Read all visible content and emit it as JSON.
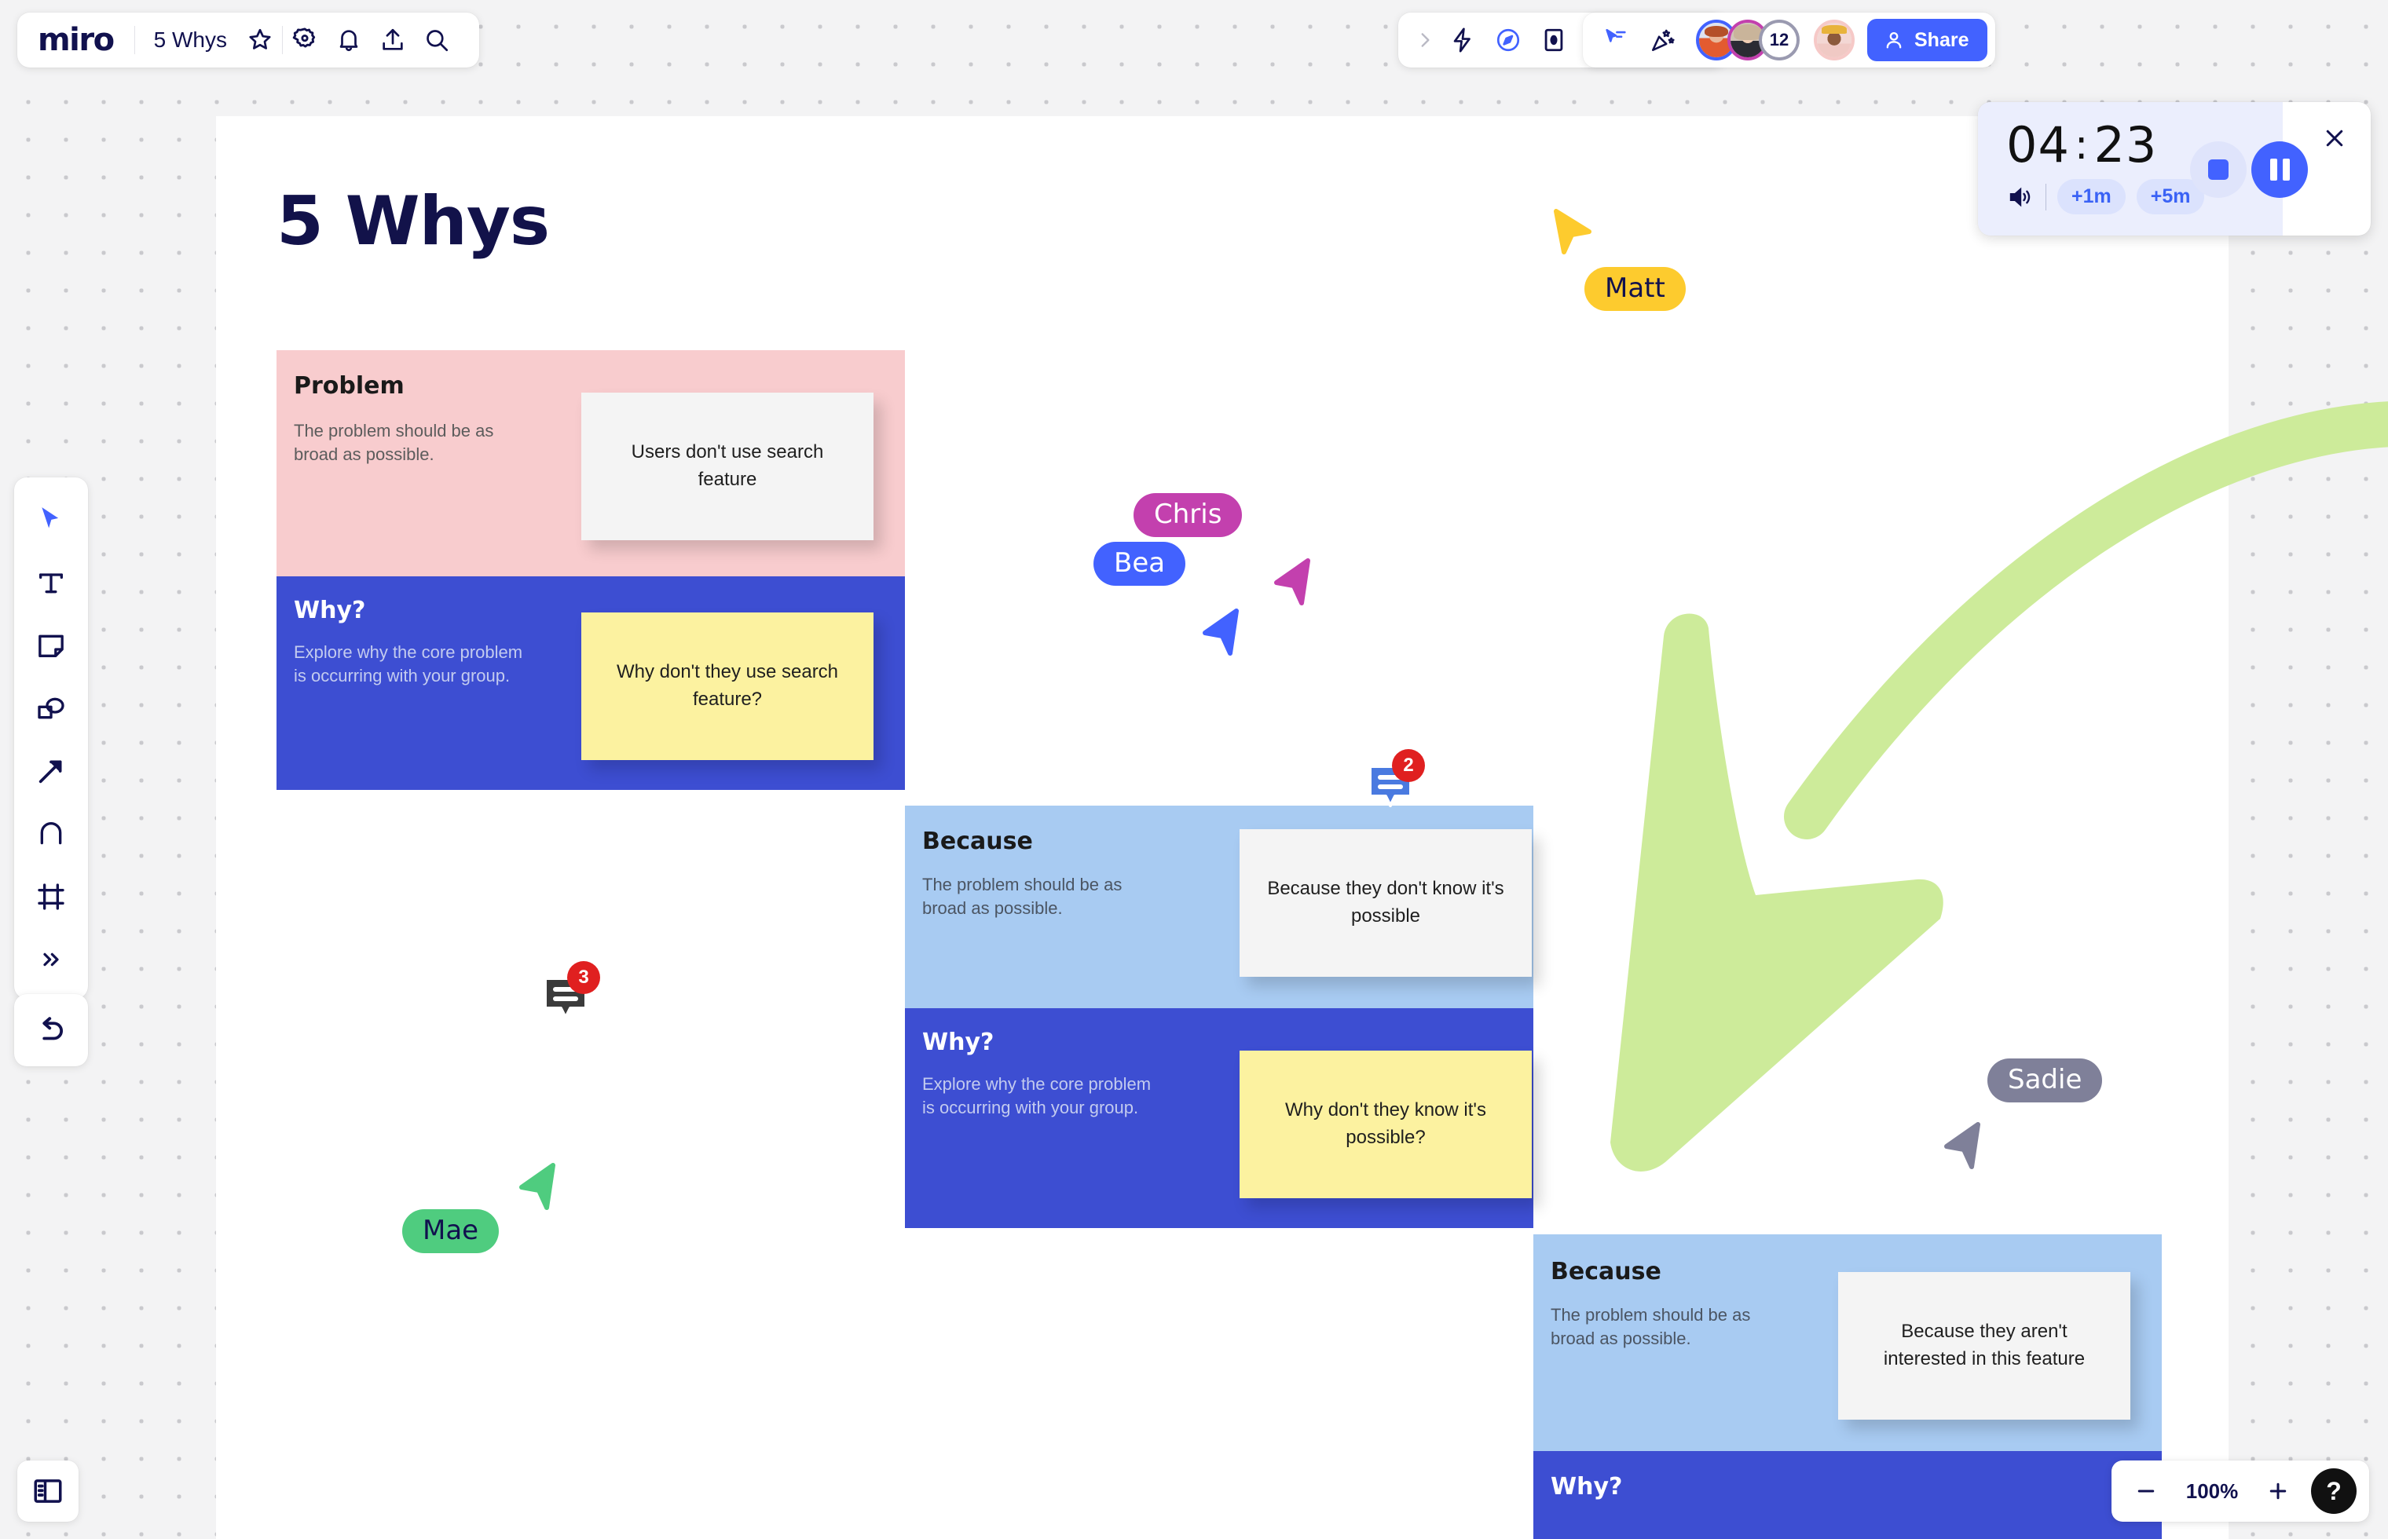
{
  "header": {
    "logo": "miro",
    "board_title": "5 Whys",
    "icons": [
      "star-icon",
      "gear-icon",
      "bell-icon",
      "upload-icon",
      "search-icon"
    ],
    "mid_icons": [
      "chevron-right-icon",
      "lightning-icon",
      "compass-icon",
      "frame-icon",
      "presentation-icon",
      "notes-icon",
      "chevron-double-down-icon"
    ],
    "right_icons": [
      "cursor-share-icon",
      "celebrate-icon"
    ],
    "avatars": [
      {
        "name": "collaborator-1",
        "label": "",
        "ring": "#4262ff"
      },
      {
        "name": "collaborator-2",
        "label": "",
        "ring": "#c340ae"
      },
      {
        "name": "collaborator-overflow",
        "label": "12",
        "ring": "#9a9ab0"
      },
      {
        "name": "current-user",
        "label": "",
        "ring": "#f6c9c7"
      }
    ],
    "share_label": "Share"
  },
  "toolbar": {
    "tools": [
      {
        "name": "select-tool",
        "icon": "cursor-icon"
      },
      {
        "name": "text-tool",
        "icon": "text-icon"
      },
      {
        "name": "sticky-note-tool",
        "icon": "sticky-note-icon"
      },
      {
        "name": "shapes-tool",
        "icon": "shapes-icon"
      },
      {
        "name": "connector-tool",
        "icon": "arrow-icon"
      },
      {
        "name": "pen-tool",
        "icon": "pen-icon"
      },
      {
        "name": "frame-tool",
        "icon": "frame-icon"
      },
      {
        "name": "more-tools",
        "icon": "chevron-double-right-icon"
      }
    ],
    "undo": "undo-icon",
    "panel": "side-panel-icon"
  },
  "board": {
    "heading": "5 Whys",
    "blocks": [
      {
        "id": "problem-block",
        "title": "Problem",
        "desc": "The problem should be as\nbroad as possible.",
        "bg": "#f8ccce",
        "sticky": {
          "text": "Users don't use search feature",
          "color": "white"
        }
      },
      {
        "id": "why-block-1",
        "title": "Why?",
        "desc": "Explore why the core problem\nis occurring with your group.",
        "bg": "#3d4ed2",
        "sticky": {
          "text": "Why don't they use search feature?",
          "color": "yellow"
        }
      },
      {
        "id": "because-block-1",
        "title": "Because",
        "desc": "The problem should be as\nbroad as possible.",
        "bg": "#a8cbf2",
        "sticky": {
          "text": "Because they don't know it's possible",
          "color": "white"
        }
      },
      {
        "id": "why-block-2",
        "title": "Why?",
        "desc": "Explore why the core problem\nis occurring with your group.",
        "bg": "#3d4ed2",
        "sticky": {
          "text": "Why don't they know it's possible?",
          "color": "yellow"
        }
      },
      {
        "id": "because-block-2",
        "title": "Because",
        "desc": "The problem should be as\nbroad as possible.",
        "bg": "#a8cbf2",
        "sticky": {
          "text": "Because they aren't interested in this feature",
          "color": "white"
        }
      },
      {
        "id": "why-block-3",
        "title": "Why?",
        "desc": "",
        "bg": "#3d4ed2",
        "sticky": null
      }
    ],
    "cursors": [
      {
        "name": "Matt",
        "color": "#fdcb2e",
        "text_color": "#11114e"
      },
      {
        "name": "Chris",
        "color": "#c340ae",
        "text_color": "#ffffff"
      },
      {
        "name": "Bea",
        "color": "#4262ff",
        "text_color": "#ffffff"
      },
      {
        "name": "Sadie",
        "color": "#7f8099",
        "text_color": "#ffffff"
      },
      {
        "name": "Mae",
        "color": "#4fcc7f",
        "text_color": "#11114e"
      }
    ],
    "comment_pins": [
      {
        "name": "comment-pin-dark",
        "count": "3",
        "color": "#3b3b3b"
      },
      {
        "name": "comment-pin-blue",
        "count": "2",
        "color": "#4a7ae0"
      }
    ],
    "arrow_color": "#cdeb9a"
  },
  "timer": {
    "minutes": "04",
    "separator": ":",
    "seconds": "23",
    "add_1m": "+1m",
    "add_5m": "+5m",
    "sound_icon": "speaker-icon",
    "stop_icon": "stop-icon",
    "pause_icon": "pause-icon",
    "close_icon": "close-icon"
  },
  "zoom": {
    "minus": "zoom-out-icon",
    "level": "100%",
    "plus": "zoom-in-icon",
    "help": "?"
  }
}
